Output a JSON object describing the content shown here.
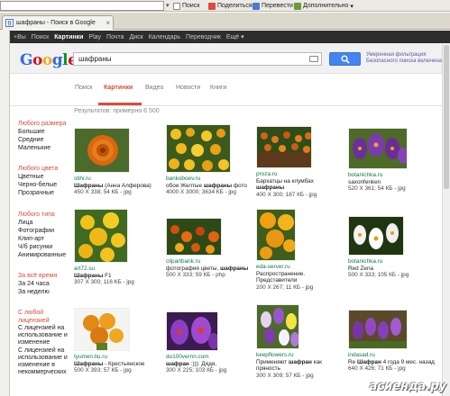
{
  "toolbar": {
    "search_label": "Поиск",
    "share_label": "Поделиться",
    "translate_label": "Перевести",
    "more_label": "Дополнительно"
  },
  "tab": {
    "title": "шафраны - Поиск в Google"
  },
  "gbar": [
    "+Вы",
    "Поиск",
    "Картинки",
    "Play",
    "Почта",
    "Диск",
    "Календарь",
    "Переводчик",
    "Ещё"
  ],
  "gbar_active": "Картинки",
  "header": {
    "logo": "Google",
    "query": "шафраны",
    "safe_line1": "Умеренная фильтрация",
    "safe_line2": "Безопасного поиска включена"
  },
  "nav": {
    "web": "Поиск",
    "images": "Картинки",
    "video": "Видео",
    "news": "Новости",
    "books": "Книги"
  },
  "results_count": "Результатов: примерно 6 500",
  "filters": {
    "size": {
      "head": "Любого размера",
      "items": [
        "Большие",
        "Средние",
        "Маленькие"
      ]
    },
    "color": {
      "head": "Любого цвета",
      "items": [
        "Цветные",
        "Черно-белые",
        "Прозрачные"
      ]
    },
    "type": {
      "head": "Любого типа",
      "items": [
        "Лица",
        "Фотографии",
        "Клип-арт",
        "Ч/б рисунки",
        "Анимированные"
      ]
    },
    "time": {
      "head": "За всё время",
      "items": [
        "За 24 часа",
        "За неделю"
      ]
    },
    "license": {
      "head": "С любой лицензией",
      "items": [
        "С лицензией на использование и изменение",
        "С лицензией на использование и изменение в некоммерческих"
      ]
    }
  },
  "results": [
    {
      "domain": "stihi.ru",
      "title_bold": "Шафраны",
      "title_rest": " (Анна Алферова)",
      "meta": "450 X 338; 54 КБ - jpg",
      "pic": "marigold-orange"
    },
    {
      "domain": "bankoboev.ru",
      "title_plain": "обои Желтые ",
      "title_bold": "шафраны",
      "title_rest": " фото",
      "meta": "4000 X 3000; 3634 КБ - jpg",
      "pic": "marigold-field"
    },
    {
      "domain": "proza.ru",
      "title_plain": "Бархатцы на клумбах",
      "title_line2_bold": "шафраны",
      "meta": "400 X 300; 187 КБ - jpg",
      "pic": "marigold-bed"
    },
    {
      "domain": "botanichka.ru",
      "title_plain": "saxonfenken",
      "meta": "520 X 361; 54 КБ - jpg",
      "pic": "crocus-purple"
    },
    {
      "domain": "art72.su",
      "title_bold": "Шафраны",
      "title_rest": " F1",
      "meta": "307 X 300; 116 КБ - jpg",
      "pic": "marigold-yellow"
    },
    {
      "domain": "clipartbank.ru",
      "title_plain": "фотография цветы, ",
      "title_bold": "шафраны",
      "meta": "500 X 333; 59 КБ - php",
      "pic": "marigold-mixed"
    },
    {
      "domain": "eda-server.ru",
      "title_plain": "Распространение.",
      "title_line2": "Представители",
      "meta": "200 X 267; 11 КБ - jpg",
      "pic": "marigold-cluster"
    },
    {
      "domain": "botanichka.ru",
      "title_plain": "Red Zena",
      "meta": "500 X 333; 105 КБ - jpg",
      "pic": "crocus-white"
    },
    {
      "domain": "tyumen.tiu.ru",
      "title_bold": "Шафраны",
      "title_rest": " - Крестьянское",
      "meta": "500 X 393; 57 КБ - jpg",
      "pic": "marigold-bouquet"
    },
    {
      "domain": "do100vernn.com",
      "title_bold": "шафран",
      "title_rest": " :))): Дядя,",
      "meta": "300 X 225; 103 КБ - jpg",
      "pic": "crocus-violet"
    },
    {
      "domain": "keepflowers.ru",
      "title_plain": "Применяют ",
      "title_bold": "шафран",
      "title_rest": " как",
      "title_line2": "пряность",
      "meta": "300 X 309; 57 КБ - jpg",
      "pic": "crocus-mixed"
    },
    {
      "domain": "indasad.ru",
      "title_plain": "Re ",
      "title_bold": "Шафран",
      "title_rest": " 4 года 9 мес. назад",
      "meta": "640 X 426; 71 КБ - jpg",
      "pic": "crocus-bed"
    }
  ],
  "watermark": "асиенда.ру",
  "colors": {
    "accent": "#dd4b39",
    "domain": "#0e774a",
    "search_button": "#4583ef",
    "gbar": "#2d2d2d"
  }
}
